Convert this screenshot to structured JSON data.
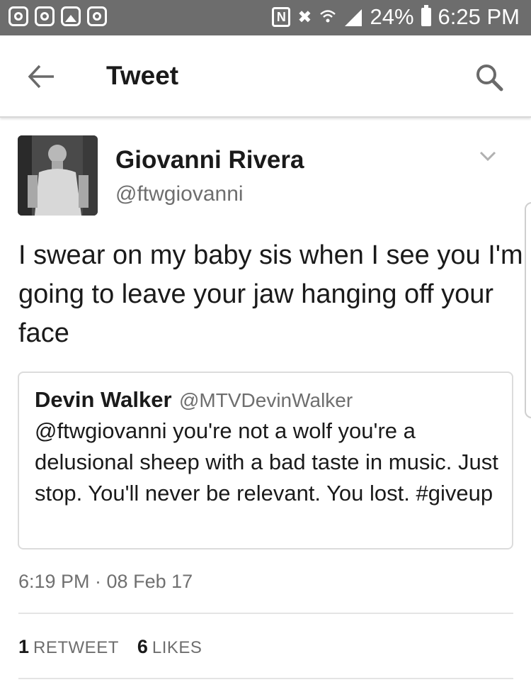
{
  "status_bar": {
    "battery": "24%",
    "time": "6:25 PM",
    "nfc_letter": "N",
    "app_icons": [
      "instagram-icon",
      "instagram-icon",
      "gallery-icon",
      "instagram-icon"
    ],
    "icons": [
      "nfc-icon",
      "mute-icon",
      "wifi-icon",
      "signal-icon",
      "battery-icon"
    ]
  },
  "header": {
    "title": "Tweet",
    "back_icon": "arrow-left-icon",
    "search_icon": "search-icon"
  },
  "tweet": {
    "author_name": "Giovanni Rivera",
    "author_handle": "@ftwgiovanni",
    "text": "I swear on my baby sis when I see you I'm going to leave your jaw hanging off your face",
    "quoted": {
      "author_name": "Devin Walker",
      "author_handle": "@MTVDevinWalker",
      "text": "@ftwgiovanni you're not a wolf you're a delusional sheep with a bad taste in music. Just stop. You'll never be relevant. You lost. #giveup"
    },
    "timestamp": "6:19 PM · 08 Feb 17",
    "stats": {
      "retweets_count": "1",
      "retweets_label": "RETWEET",
      "likes_count": "6",
      "likes_label": "LIKES"
    }
  },
  "colors": {
    "status_bar_bg": "#6d6d6d",
    "text_primary": "#1a1a1a",
    "text_secondary": "#6e6e6e",
    "divider": "#e4e4e4"
  }
}
